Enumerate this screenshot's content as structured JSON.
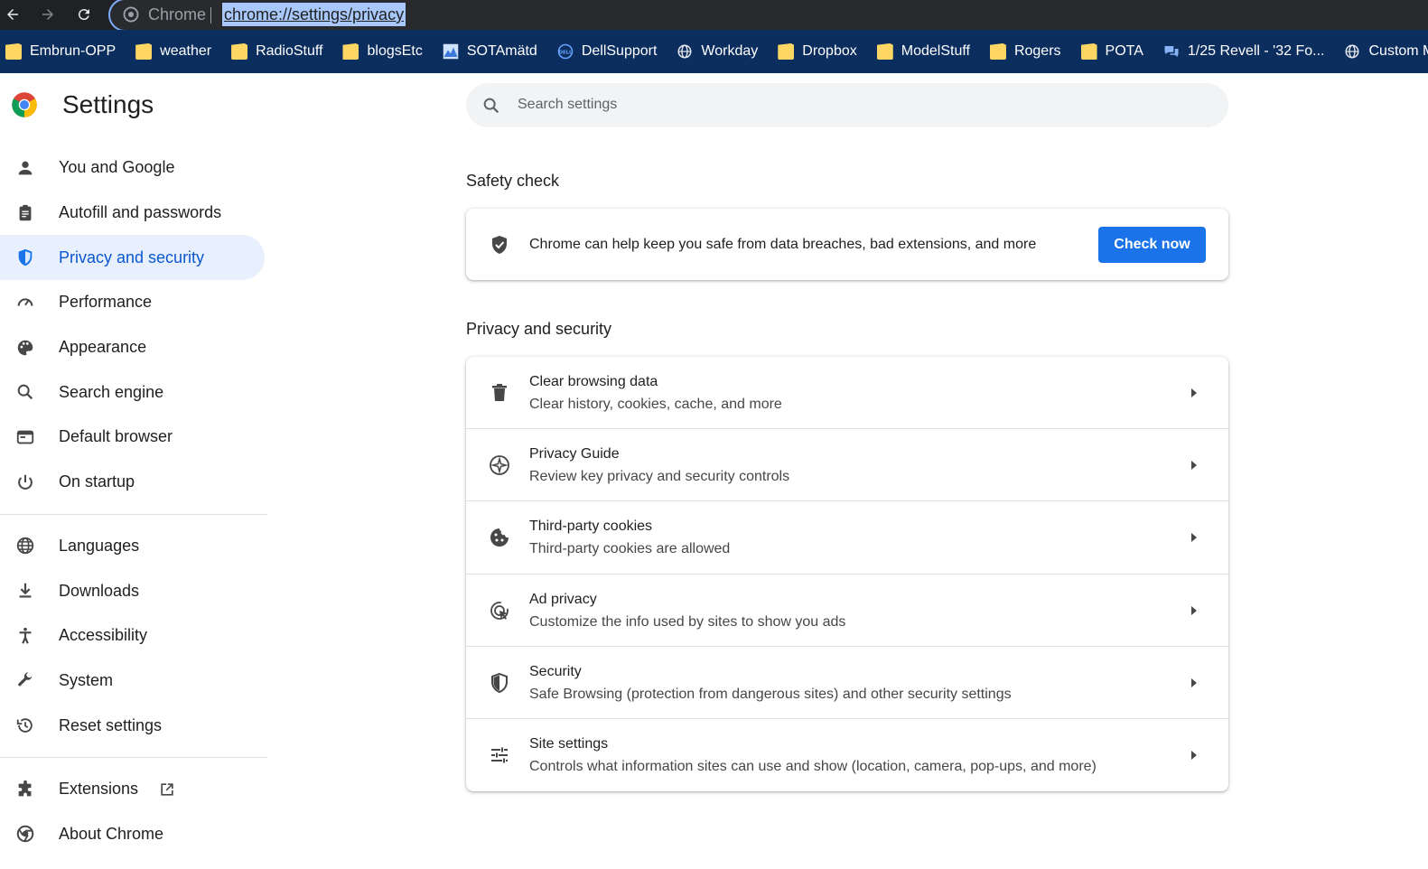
{
  "omnibox": {
    "chip_label": "Chrome",
    "url": "chrome://settings/privacy"
  },
  "bookmarks": [
    {
      "label": "Embrun-OPP",
      "icon": "folder-icon"
    },
    {
      "label": "weather",
      "icon": "folder-icon"
    },
    {
      "label": "RadioStuff",
      "icon": "folder-icon"
    },
    {
      "label": "blogsEtc",
      "icon": "folder-icon"
    },
    {
      "label": "SOTAmätd",
      "icon": "site-favicon-icon"
    },
    {
      "label": "DellSupport",
      "icon": "dell-icon"
    },
    {
      "label": "Workday",
      "icon": "globe-icon"
    },
    {
      "label": "Dropbox",
      "icon": "folder-icon"
    },
    {
      "label": "ModelStuff",
      "icon": "folder-icon"
    },
    {
      "label": "Rogers",
      "icon": "folder-icon"
    },
    {
      "label": "POTA",
      "icon": "folder-icon"
    },
    {
      "label": "1/25 Revell - '32 Fo...",
      "icon": "chat-icon"
    },
    {
      "label": "Custom Model Sc",
      "icon": "globe-icon"
    }
  ],
  "header": {
    "title": "Settings",
    "search_placeholder": "Search settings"
  },
  "sidebar": {
    "items": [
      {
        "label": "You and Google",
        "icon": "person-icon"
      },
      {
        "label": "Autofill and passwords",
        "icon": "clipboard-icon"
      },
      {
        "label": "Privacy and security",
        "icon": "shield-icon",
        "active": true
      },
      {
        "label": "Performance",
        "icon": "speedometer-icon"
      },
      {
        "label": "Appearance",
        "icon": "palette-icon"
      },
      {
        "label": "Search engine",
        "icon": "search-icon"
      },
      {
        "label": "Default browser",
        "icon": "browser-icon"
      },
      {
        "label": "On startup",
        "icon": "power-icon"
      },
      {
        "label": "Languages",
        "icon": "globe-icon"
      },
      {
        "label": "Downloads",
        "icon": "download-icon"
      },
      {
        "label": "Accessibility",
        "icon": "accessibility-icon"
      },
      {
        "label": "System",
        "icon": "wrench-icon"
      },
      {
        "label": "Reset settings",
        "icon": "history-icon"
      },
      {
        "label": "Extensions",
        "icon": "puzzle-icon"
      },
      {
        "label": "About Chrome",
        "icon": "chrome-icon"
      }
    ]
  },
  "safety_check": {
    "title": "Safety check",
    "description": "Chrome can help keep you safe from data breaches, bad extensions, and more",
    "button": "Check now"
  },
  "privacy": {
    "title": "Privacy and security",
    "rows": [
      {
        "title": "Clear browsing data",
        "subtitle": "Clear history, cookies, cache, and more",
        "icon": "trash-icon"
      },
      {
        "title": "Privacy Guide",
        "subtitle": "Review key privacy and security controls",
        "icon": "compass-icon"
      },
      {
        "title": "Third-party cookies",
        "subtitle": "Third-party cookies are allowed",
        "icon": "cookie-icon"
      },
      {
        "title": "Ad privacy",
        "subtitle": "Customize the info used by sites to show you ads",
        "icon": "ad-target-icon"
      },
      {
        "title": "Security",
        "subtitle": "Safe Browsing (protection from dangerous sites) and other security settings",
        "icon": "security-shield-icon"
      },
      {
        "title": "Site settings",
        "subtitle": "Controls what information sites can use and show (location, camera, pop-ups, and more)",
        "icon": "sliders-icon"
      }
    ]
  },
  "colors": {
    "accent": "#1a73e8",
    "active_nav_bg": "#e8f0fe",
    "active_nav_text": "#0b57d0",
    "bookmark_bar": "#0b2e5f"
  }
}
